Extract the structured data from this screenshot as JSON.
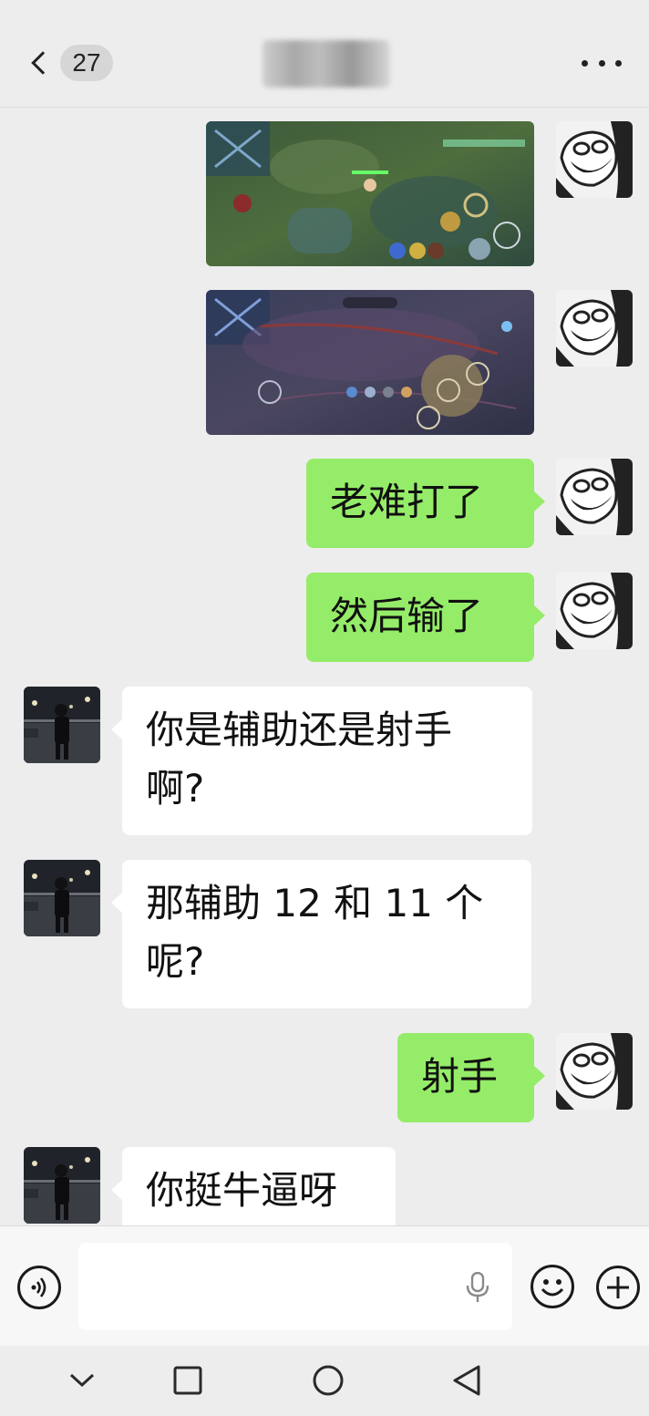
{
  "header": {
    "unread_count": "27"
  },
  "messages": [
    {
      "from": "me",
      "type": "image"
    },
    {
      "from": "me",
      "type": "image"
    },
    {
      "from": "me",
      "type": "text",
      "text": "老难打了"
    },
    {
      "from": "me",
      "type": "text",
      "text": "然后输了"
    },
    {
      "from": "peer",
      "type": "text",
      "text": "你是辅助还是射手啊?"
    },
    {
      "from": "peer",
      "type": "text",
      "text": "那辅助 12 和 11 个呢?"
    },
    {
      "from": "me",
      "type": "text",
      "text": "射手"
    },
    {
      "from": "peer",
      "type": "text",
      "text": "你挺牛逼呀"
    }
  ],
  "input_bar": {
    "text_value": "",
    "icons": [
      "voice-icon",
      "mic-icon",
      "emoji-icon",
      "plus-icon"
    ]
  },
  "navbar": {
    "icons": [
      "nav-down-icon",
      "nav-recents-icon",
      "nav-home-icon",
      "nav-back-icon"
    ]
  },
  "colors": {
    "background": "#ededed",
    "my_bubble": "#95ec69",
    "peer_bubble": "#ffffff"
  }
}
